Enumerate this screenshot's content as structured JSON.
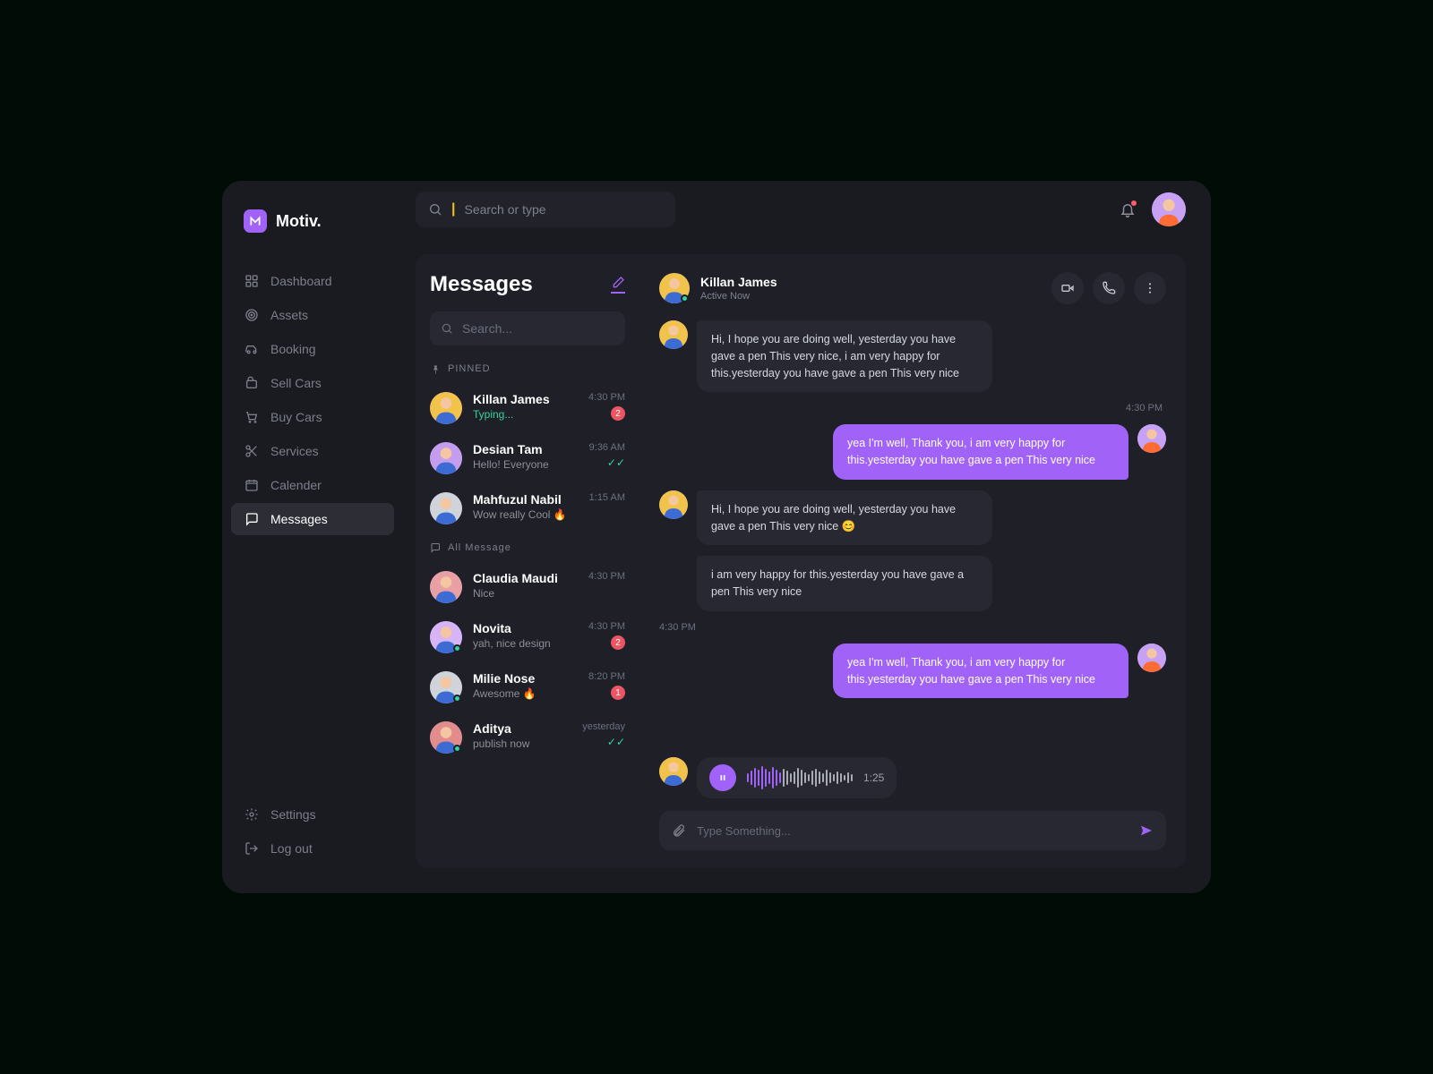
{
  "brand": {
    "name": "Motiv."
  },
  "topbar": {
    "search_placeholder": "Search or type"
  },
  "sidebar": {
    "items": [
      {
        "label": "Dashboard",
        "icon": "dashboard"
      },
      {
        "label": "Assets",
        "icon": "target"
      },
      {
        "label": "Booking",
        "icon": "car"
      },
      {
        "label": "Sell Cars",
        "icon": "bag"
      },
      {
        "label": "Buy Cars",
        "icon": "cart"
      },
      {
        "label": "Services",
        "icon": "scissors"
      },
      {
        "label": "Calender",
        "icon": "calendar"
      },
      {
        "label": "Messages",
        "icon": "chat",
        "active": true
      }
    ],
    "footer": [
      {
        "label": "Settings",
        "icon": "gear"
      },
      {
        "label": "Log out",
        "icon": "logout"
      }
    ]
  },
  "messages": {
    "title": "Messages",
    "search_placeholder": "Search...",
    "pinned_label": "PINNED",
    "all_label": "All Message",
    "pinned": [
      {
        "name": "Killan James",
        "preview": "Typing...",
        "time": "4:30 PM",
        "badge": "2",
        "typing": true,
        "color": "#f1c34a"
      },
      {
        "name": "Desian Tam",
        "preview": "Hello! Everyone",
        "time": "9:36 AM",
        "read": true,
        "color": "#c59dee"
      },
      {
        "name": "Mahfuzul Nabil",
        "preview": "Wow really Cool 🔥",
        "time": "1:15 AM",
        "color": "#cfd3da"
      }
    ],
    "all": [
      {
        "name": "Claudia Maudi",
        "preview": "Nice",
        "time": "4:30 PM",
        "color": "#e9a0a5"
      },
      {
        "name": "Novita",
        "preview": "yah, nice design",
        "time": "4:30 PM",
        "badge": "2",
        "color": "#d6b4f5",
        "online": true
      },
      {
        "name": "Milie Nose",
        "preview": "Awesome 🔥",
        "time": "8:20 PM",
        "badge": "1",
        "color": "#cfd3da",
        "online": true
      },
      {
        "name": "Aditya",
        "preview": "publish now",
        "time": "yesterday",
        "read": true,
        "color": "#e38c8c",
        "online": true
      }
    ]
  },
  "chat": {
    "peer_name": "Killan James",
    "peer_status": "Active Now",
    "thread": [
      {
        "side": "left",
        "text": "Hi, I hope you are doing well, yesterday you have gave a pen This very nice, i am very happy for this.yesterday you have gave a pen This very nice"
      },
      {
        "timestamp": "4:30 PM",
        "align": "right"
      },
      {
        "side": "right",
        "text": "yea I'm well, Thank you, i am very happy for this.yesterday you have gave a pen This very nice"
      },
      {
        "side": "left",
        "text": "Hi, I hope you are doing well, yesterday you have gave a pen This very nice 😊"
      },
      {
        "side": "left",
        "noavatar": true,
        "text": "i am very happy for this.yesterday you have gave a pen This very nice"
      },
      {
        "timestamp": "4:30 PM",
        "align": "left"
      },
      {
        "side": "right",
        "text": "yea I'm well, Thank you, i am very happy for this.yesterday you have gave a pen This very nice"
      }
    ],
    "voice": {
      "duration": "1:25"
    },
    "composer_placeholder": "Type Something..."
  }
}
